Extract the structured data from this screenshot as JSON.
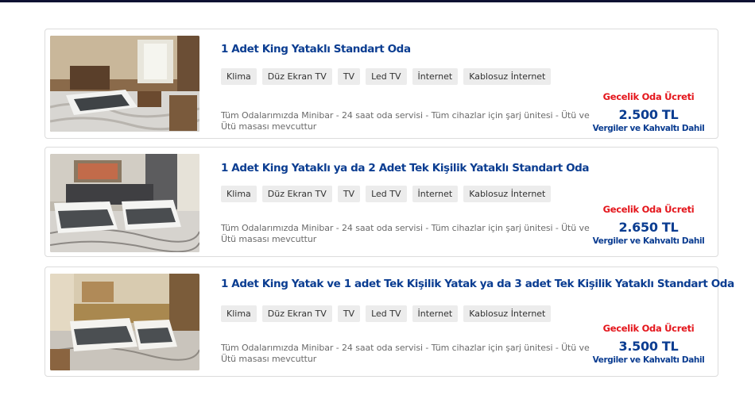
{
  "colors": {
    "title": "#0b3d91",
    "price_label": "#e4161c",
    "tag_bg": "#ececec",
    "top_bar": "#0f1133"
  },
  "rooms": [
    {
      "title": "1 Adet King Yataklı Standart Oda",
      "features": [
        "Klima",
        "Düz Ekran TV",
        "TV",
        "Led TV",
        "İnternet",
        "Kablosuz İnternet"
      ],
      "description": "Tüm Odalarımızda Minibar - 24 saat oda servisi - Tüm cihazlar için şarj ünitesi - Ütü ve Ütü masası mevcuttur",
      "price_label": "Gecelik Oda Ücreti",
      "price": "2.500 TL",
      "price_note": "Vergiler ve Kahvaltı Dahil"
    },
    {
      "title": "1 Adet King Yataklı ya da 2 Adet Tek Kişilik Yataklı Standart Oda",
      "features": [
        "Klima",
        "Düz Ekran TV",
        "TV",
        "Led TV",
        "İnternet",
        "Kablosuz İnternet"
      ],
      "description": "Tüm Odalarımızda Minibar - 24 saat oda servisi - Tüm cihazlar için şarj ünitesi - Ütü ve Ütü masası mevcuttur",
      "price_label": "Gecelik Oda Ücreti",
      "price": "2.650 TL",
      "price_note": "Vergiler ve Kahvaltı Dahil"
    },
    {
      "title": "1 Adet King Yatak ve 1 adet Tek Kişilik Yatak ya da 3 adet Tek Kişilik Yataklı Standart Oda",
      "features": [
        "Klima",
        "Düz Ekran TV",
        "TV",
        "Led TV",
        "İnternet",
        "Kablosuz İnternet"
      ],
      "description": "Tüm Odalarımızda Minibar - 24 saat oda servisi - Tüm cihazlar için şarj ünitesi - Ütü ve Ütü masası mevcuttur",
      "price_label": "Gecelik Oda Ücreti",
      "price": "3.500 TL",
      "price_note": "Vergiler ve Kahvaltı Dahil"
    }
  ]
}
